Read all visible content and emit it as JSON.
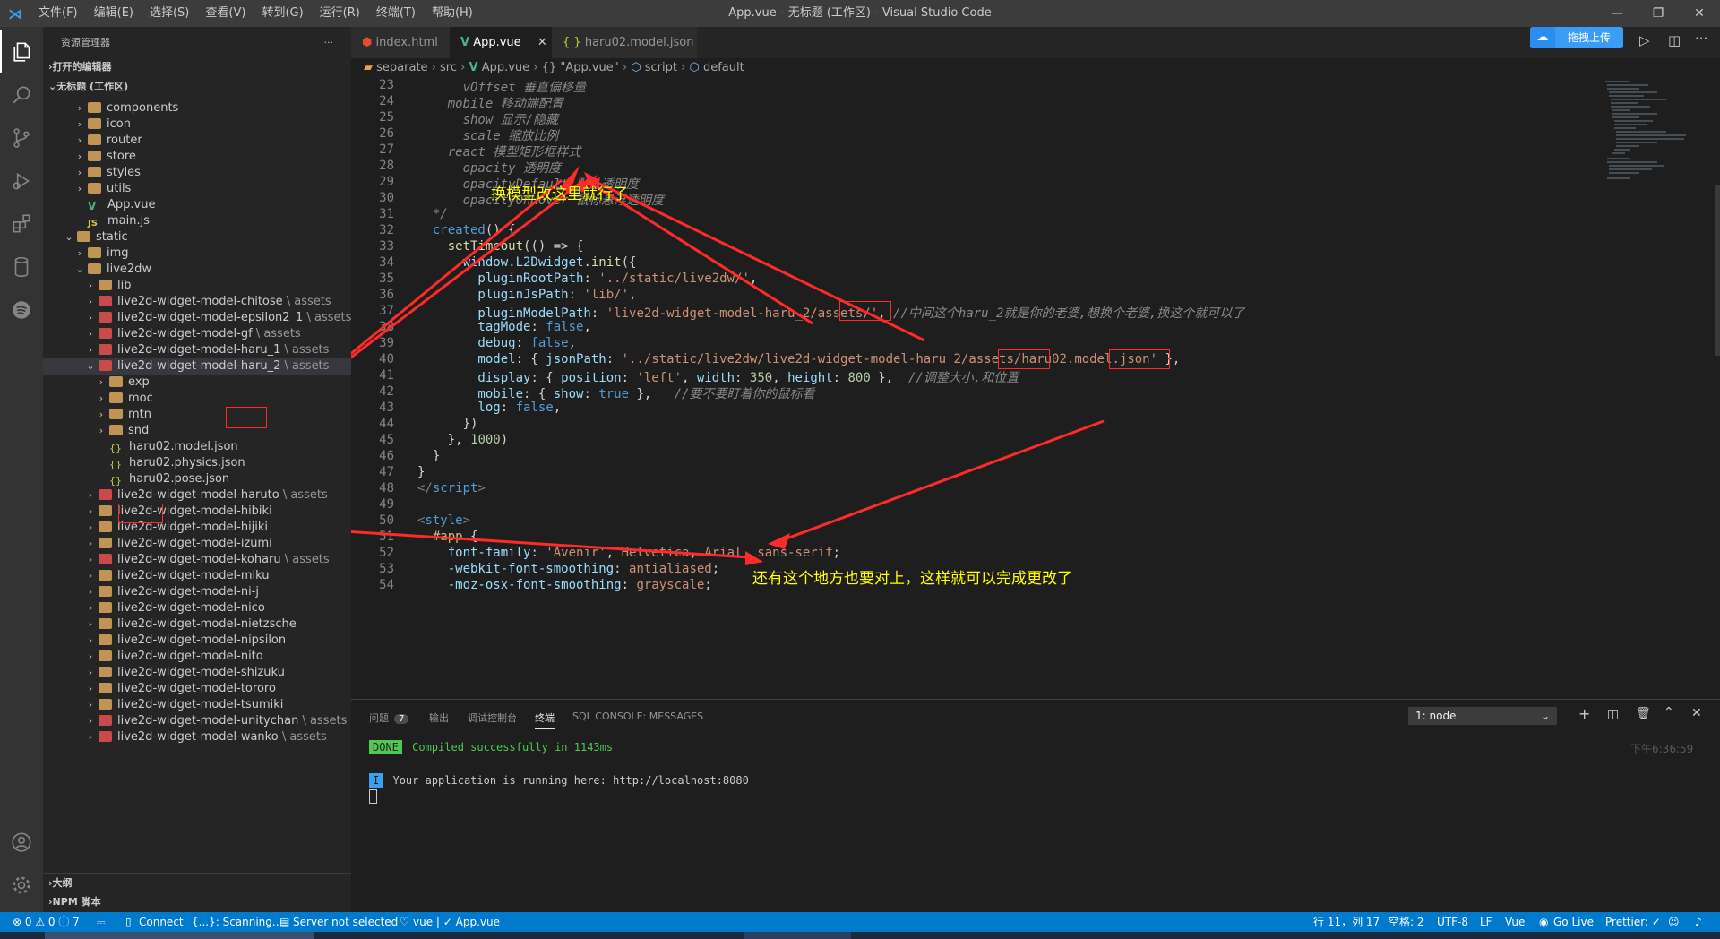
{
  "titlebar": {
    "menu": [
      "文件(F)",
      "编辑(E)",
      "选择(S)",
      "查看(V)",
      "转到(G)",
      "运行(R)",
      "终端(T)",
      "帮助(H)"
    ],
    "title": "App.vue - 无标题 (工作区) - Visual Studio Code"
  },
  "sidebar": {
    "header": "资源管理器",
    "more": "···",
    "open_editors": "打开的编辑器",
    "workspace": "无标题 (工作区)",
    "outline": "大纲",
    "npm": "NPM 脚本",
    "tree": [
      {
        "label": "components",
        "suffix": ""
      },
      {
        "label": "icon",
        "suffix": ""
      },
      {
        "label": "router",
        "suffix": ""
      },
      {
        "label": "store",
        "suffix": ""
      },
      {
        "label": "styles",
        "suffix": ""
      },
      {
        "label": "utils",
        "suffix": ""
      },
      {
        "label": "App.vue",
        "suffix": ""
      },
      {
        "label": "main.js",
        "suffix": ""
      },
      {
        "label": "static",
        "suffix": ""
      },
      {
        "label": "img",
        "suffix": ""
      },
      {
        "label": "live2dw",
        "suffix": ""
      },
      {
        "label": "lib",
        "suffix": ""
      },
      {
        "label": "live2d-widget-model-chitose",
        "suffix": " \\ assets"
      },
      {
        "label": "live2d-widget-model-epsilon2_1",
        "suffix": " \\ assets"
      },
      {
        "label": "live2d-widget-model-gf",
        "suffix": " \\ assets"
      },
      {
        "label": "live2d-widget-model-haru_1",
        "suffix": " \\ assets"
      },
      {
        "label": "live2d-widget-model-haru_2",
        "suffix": " \\ assets"
      },
      {
        "label": "exp",
        "suffix": ""
      },
      {
        "label": "moc",
        "suffix": ""
      },
      {
        "label": "mtn",
        "suffix": ""
      },
      {
        "label": "snd",
        "suffix": ""
      },
      {
        "label": "haru02.model.json",
        "suffix": ""
      },
      {
        "label": "haru02.physics.json",
        "suffix": ""
      },
      {
        "label": "haru02.pose.json",
        "suffix": ""
      },
      {
        "label": "live2d-widget-model-haruto",
        "suffix": " \\ assets"
      },
      {
        "label": "live2d-widget-model-hibiki",
        "suffix": ""
      },
      {
        "label": "live2d-widget-model-hijiki",
        "suffix": ""
      },
      {
        "label": "live2d-widget-model-izumi",
        "suffix": ""
      },
      {
        "label": "live2d-widget-model-koharu",
        "suffix": " \\ assets"
      },
      {
        "label": "live2d-widget-model-miku",
        "suffix": ""
      },
      {
        "label": "live2d-widget-model-ni-j",
        "suffix": ""
      },
      {
        "label": "live2d-widget-model-nico",
        "suffix": ""
      },
      {
        "label": "live2d-widget-model-nietzsche",
        "suffix": ""
      },
      {
        "label": "live2d-widget-model-nipsilon",
        "suffix": ""
      },
      {
        "label": "live2d-widget-model-nito",
        "suffix": ""
      },
      {
        "label": "live2d-widget-model-shizuku",
        "suffix": ""
      },
      {
        "label": "live2d-widget-model-tororo",
        "suffix": ""
      },
      {
        "label": "live2d-widget-model-tsumiki",
        "suffix": ""
      },
      {
        "label": "live2d-widget-model-unitychan",
        "suffix": " \\ assets"
      },
      {
        "label": "live2d-widget-model-wanko",
        "suffix": " \\ assets"
      }
    ]
  },
  "tabs": [
    {
      "label": "index.html"
    },
    {
      "label": "App.vue"
    },
    {
      "label": "haru02.model.json"
    }
  ],
  "upload_button": "拖拽上传",
  "breadcrumb": [
    "separate",
    "src",
    "App.vue",
    "{} \"App.vue\"",
    "script",
    "default"
  ],
  "line_numbers": [
    "23",
    "24",
    "25",
    "26",
    "27",
    "28",
    "29",
    "30",
    "31",
    "32",
    "33",
    "34",
    "35",
    "36",
    "37",
    "38",
    "39",
    "40",
    "41",
    "42",
    "43",
    "44",
    "45",
    "46",
    "47",
    "48",
    "49",
    "50",
    "51",
    "52",
    "53",
    "54"
  ],
  "code": {
    "l23": "      vOffset 垂直偏移量",
    "l24": "    mobile 移动端配置",
    "l25": "      show 显示/隐藏",
    "l26": "      scale 缩放比例",
    "l27": "    react 模型矩形框样式",
    "l28": "      opacity 透明度",
    "l29": "      opacityDefault 默认透明度",
    "l30": "      opacityOnHover 鼠标悬浮透明度",
    "l31": "  */",
    "l32a": "  created",
    "l32b": "() {",
    "l33a": "    setTimeout",
    "l33b": "(() => {",
    "l34a": "      window.",
    "l34b": "L2Dwidget",
    "l34c": ".",
    "l34d": "init",
    "l34e": "({",
    "l35a": "        pluginRootPath",
    "l35b": ": ",
    "l35c": "'../static/live2dw/'",
    "l35d": ",",
    "l36a": "        pluginJsPath",
    "l36b": ": ",
    "l36c": "'lib/'",
    "l36d": ",",
    "l37a": "        pluginModelPath",
    "l37b": ": ",
    "l37c": "'live2d-widget-model-haru_2/assets/'",
    "l37d": ", ",
    "l37e": "//中间这个haru_2就是你的老婆,想换个老婆,换这个就可以了",
    "l38a": "        tagMode",
    "l38b": ": ",
    "l38c": "false",
    "l38d": ",",
    "l39a": "        debug",
    "l39b": ": ",
    "l39c": "false",
    "l39d": ",",
    "l40a": "        model",
    "l40b": ": { ",
    "l40c": "jsonPath",
    "l40d": ": ",
    "l40e": "'../static/live2dw/live2d-widget-model-haru_2/assets/haru02.model.json'",
    "l40f": " },",
    "l41a": "        display",
    "l41b": ": { ",
    "l41c": "position",
    "l41d": ": ",
    "l41e": "'left'",
    "l41f": ", ",
    "l41g": "width",
    "l41h": ": ",
    "l41i": "350",
    "l41j": ", ",
    "l41k": "height",
    "l41l": ": ",
    "l41m": "800",
    "l41n": " },  ",
    "l41o": "//调整大小,和位置",
    "l42a": "        mobile",
    "l42b": ": { ",
    "l42c": "show",
    "l42d": ": ",
    "l42e": "true",
    "l42f": " },   ",
    "l42g": "//要不要盯着你的鼠标看",
    "l43a": "        log",
    "l43b": ": ",
    "l43c": "false",
    "l43d": ",",
    "l44": "      })",
    "l45a": "    }, ",
    "l45b": "1000",
    "l45c": ")",
    "l46": "  }",
    "l47": "}",
    "l48a": "</",
    "l48b": "script",
    "l48c": ">",
    "l49": "",
    "l50a": "<",
    "l50b": "style",
    "l50c": ">",
    "l51a": "  #app",
    "l51b": " {",
    "l52a": "    font-family",
    "l52b": ": ",
    "l52c": "'Avenir'",
    "l52d": ", ",
    "l52e": "Helvetica",
    "l52f": ", ",
    "l52g": "Arial",
    "l52h": ", ",
    "l52i": "sans-serif",
    "l52j": ";",
    "l53a": "    -webkit-font-smoothing",
    "l53b": ": ",
    "l53c": "antialiased",
    "l53d": ";",
    "l54a": "    -moz-osx-font-smoothing",
    "l54b": ": ",
    "l54c": "grayscale",
    "l54d": ";"
  },
  "annotations": {
    "a1": "换模型改这里就行了",
    "a2": "还有这个地方也要对上，这样就可以完成更改了"
  },
  "panel": {
    "tabs": [
      "问题",
      "输出",
      "调试控制台",
      "终端",
      "SQL CONSOLE: MESSAGES"
    ],
    "problems_count": "7",
    "terminal_select": "1: node",
    "done_badge": "DONE",
    "compiled": "Compiled successfully in 1143ms",
    "timestamp": "下午6:36:59",
    "info_badge": "I",
    "running": "Your application is running here: http://localhost:8080"
  },
  "status": {
    "errors": "⊗ 0 ⚠ 0 ⓘ 7",
    "connect": "Connect",
    "scanning": "{...}: Scanning..",
    "server": "Server not selected",
    "vue": "vue | ✓ App.vue",
    "position": "行 11，列 17",
    "spaces": "空格: 2",
    "encoding": "UTF-8",
    "eol": "LF",
    "lang": "Vue",
    "golive": "Go Live",
    "prettier": "Prettier: ✓"
  },
  "colors": {
    "accent": "#007acc",
    "annotation": "#ffff00",
    "arrow": "#ff2a2a"
  }
}
